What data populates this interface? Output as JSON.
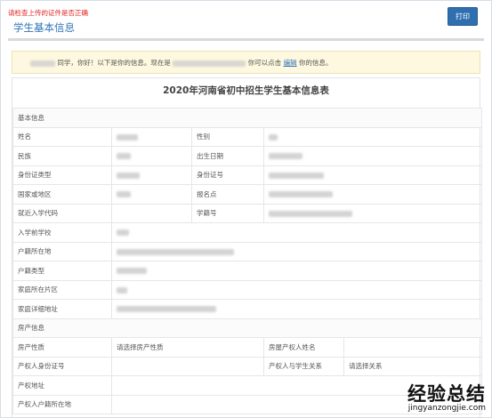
{
  "header": {
    "warning": "请检查上传的证件是否正确",
    "section_title": "学生基本信息",
    "print_label": "打印"
  },
  "notice": {
    "greeting": "同学，你好！以下是你的信息。现在是",
    "middle": "你可以点击",
    "edit_link": "编辑",
    "suffix": "你的信息。"
  },
  "form": {
    "title": "2020年河南省初中招生学生基本信息表",
    "groups": {
      "basic": "基本信息",
      "property": "房产信息"
    },
    "labels": {
      "name": "姓名",
      "gender": "性别",
      "ethnicity": "民族",
      "birth_date": "出生日期",
      "id_type": "身份证类型",
      "id_number": "身份证号",
      "country": "国家或地区",
      "enroll_point": "报名点",
      "nearby_code": "就近入学代码",
      "student_no": "学籍号",
      "prev_school": "入学前学校",
      "hukou_location": "户籍所在地",
      "hukou_type": "户籍类型",
      "home_district": "家庭所在片区",
      "home_address": "家庭详细地址",
      "property_nature": "房产性质",
      "owner_name": "房屋产权人姓名",
      "owner_id": "产权人身份证号",
      "owner_relation": "产权人与学生关系",
      "property_address": "产权地址",
      "owner_hukou": "产权人户籍所在地"
    },
    "placeholders": {
      "property_nature": "请选择房产性质",
      "owner_relation": "请选择关系"
    }
  },
  "watermark": {
    "brand": "经验总结",
    "url": "jingyanzongjie.com"
  }
}
